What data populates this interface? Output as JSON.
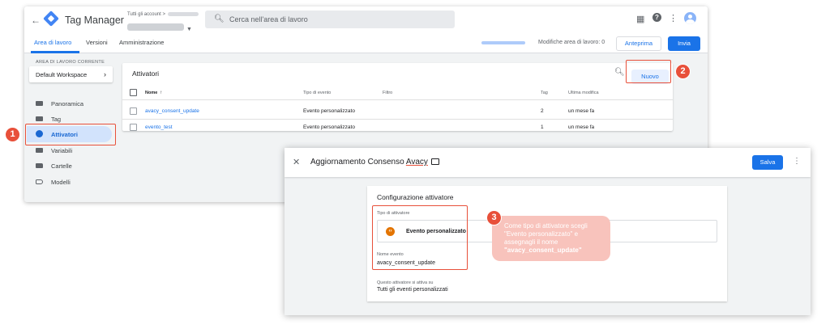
{
  "app": {
    "title": "Tag Manager",
    "account_breadcrumb": "Tutti gli account >",
    "search_placeholder": "Cerca nell'area di lavoro"
  },
  "nav": {
    "tabs": [
      {
        "label": "Area di lavoro",
        "active": true
      },
      {
        "label": "Versioni",
        "active": false
      },
      {
        "label": "Amministrazione",
        "active": false
      }
    ],
    "changes_label": "Modifiche area di lavoro: 0",
    "preview_label": "Anteprima",
    "submit_label": "Invia"
  },
  "sidebar": {
    "header": "AREA DI LAVORO CORRENTE",
    "workspace": "Default Workspace",
    "items": [
      {
        "label": "Panoramica",
        "icon": "overview-icon",
        "active": false
      },
      {
        "label": "Tag",
        "icon": "tag-icon",
        "active": false
      },
      {
        "label": "Attivatori",
        "icon": "trigger-icon",
        "active": true
      },
      {
        "label": "Variabili",
        "icon": "variables-icon",
        "active": false
      },
      {
        "label": "Cartelle",
        "icon": "folder-icon",
        "active": false
      },
      {
        "label": "Modelli",
        "icon": "template-icon",
        "active": false
      }
    ]
  },
  "triggers": {
    "title": "Attivatori",
    "new_label": "Nuovo",
    "columns": {
      "name": "Nome",
      "sort_arrow": "↑",
      "event_type": "Tipo di evento",
      "filter": "Filtro",
      "tags": "Tag",
      "last_modified": "Ultima modifica"
    },
    "rows": [
      {
        "name": "avacy_consent_update",
        "event_type": "Evento personalizzato",
        "filter": "",
        "tags": "2",
        "last_modified": "un mese fa"
      },
      {
        "name": "evento_test",
        "event_type": "Evento personalizzato",
        "filter": "",
        "tags": "1",
        "last_modified": "un mese fa"
      }
    ]
  },
  "dialog": {
    "title_prefix": "Aggiornamento Consenso ",
    "title_suffix": "Avacy",
    "save_label": "Salva",
    "config_title": "Configurazione attivatore",
    "type_label": "Tipo di attivatore",
    "type_value": "Evento personalizzato",
    "type_icon_glyph": "‹›",
    "event_name_label": "Nome evento",
    "event_name_value": "avacy_consent_update",
    "fires_on_label": "Questo attivatore si attiva su",
    "fires_on_value": "Tutti gli eventi personalizzati"
  },
  "annotations": {
    "step1": "1",
    "step2": "2",
    "step3": "3",
    "callout_text": "Come tipo di attivatore scegli \"Evento personalizzato\" e assegnagli il nome",
    "callout_highlight": "\"avacy_consent_update\""
  },
  "colors": {
    "accent": "#1a73e8",
    "highlight": "#e8503a",
    "callout_bg": "#f8c3bc",
    "trigger_type_icon": "#e37400"
  }
}
